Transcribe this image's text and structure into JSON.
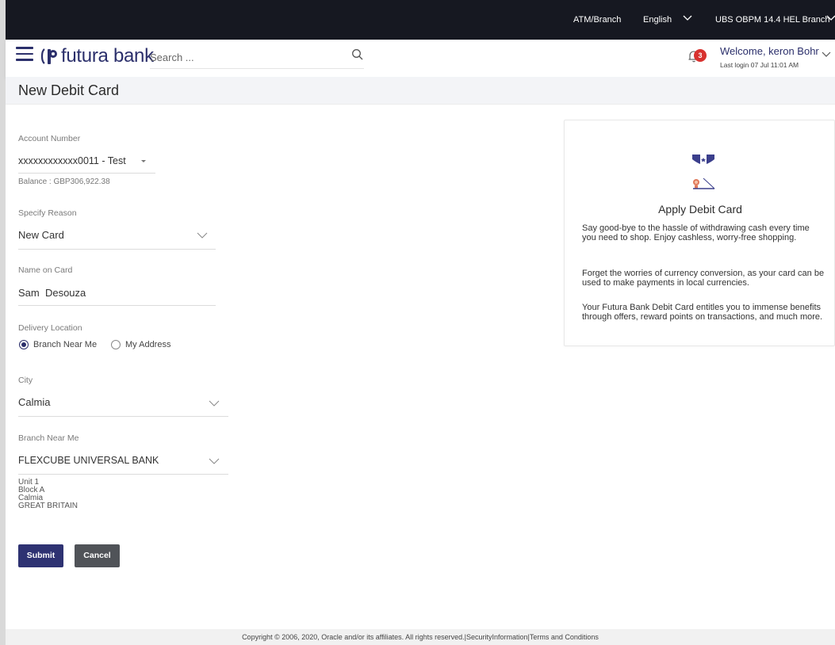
{
  "topbar": {
    "atm_branch": "ATM/Branch",
    "language": "English",
    "entity": "UBS OBPM 14.4 HEL Branch"
  },
  "header": {
    "brand": "futura bank",
    "search_placeholder": "Search ...",
    "notification_count": "3",
    "welcome": "Welcome, keron Bohr",
    "last_login": "Last login 07 Jul 11:01 AM"
  },
  "page": {
    "title": "New Debit Card"
  },
  "form": {
    "account_number_label": "Account Number",
    "account_number_value": "xxxxxxxxxxxx0011 - Test",
    "balance": "Balance : GBP306,922.38",
    "reason_label": "Specify Reason",
    "reason_value": "New Card",
    "name_label": "Name on Card",
    "name_value": "Sam  Desouza",
    "delivery_label": "Delivery Location",
    "delivery_options": [
      "Branch Near Me",
      "My Address"
    ],
    "delivery_selected": "Branch Near Me",
    "city_label": "City",
    "city_value": "Calmia",
    "branch_label": "Branch Near Me",
    "branch_value": "FLEXCUBE UNIVERSAL BANK",
    "branch_address": [
      "Unit 1",
      "Block A",
      "Calmia",
      "GREAT BRITAIN"
    ],
    "submit_label": "Submit",
    "cancel_label": "Cancel"
  },
  "info_card": {
    "title": "Apply Debit Card",
    "paragraphs": [
      "Say good-bye to the hassle of withdrawing cash every time you need to shop. Enjoy cashless, worry-free shopping.",
      "Forget the worries of currency conversion, as your card can be used to make payments in local currencies.",
      "Your Futura Bank Debit Card entitles you to immense benefits through offers, reward points on transactions, and much more."
    ]
  },
  "footer": {
    "text": "Copyright © 2006, 2020, Oracle and/or its affiliates. All rights reserved.|SecurityInformation|Terms and Conditions"
  },
  "colors": {
    "topbar_bg": "#161821",
    "brand": "#2b2f6b",
    "submit_bg": "#2e3272",
    "cancel_bg": "#505358",
    "badge": "#d8322f"
  }
}
